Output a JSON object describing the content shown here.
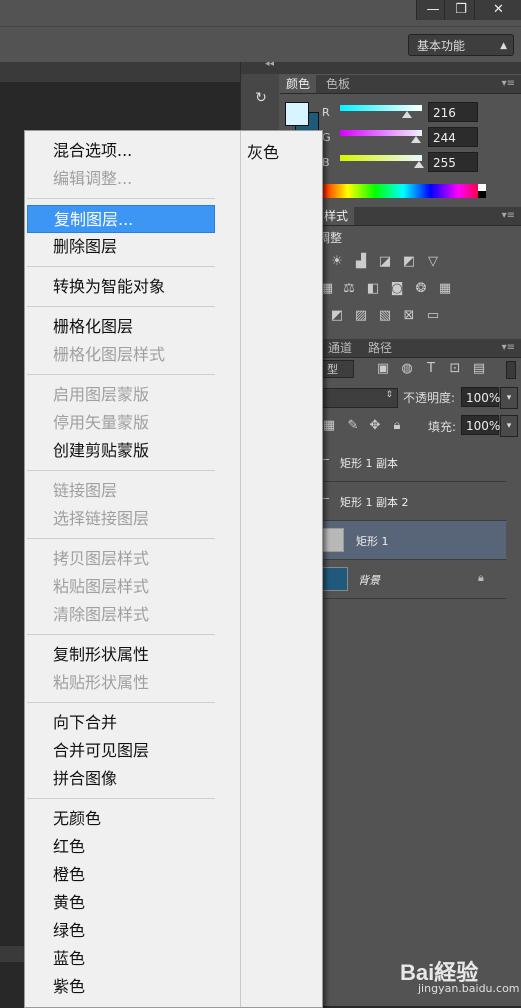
{
  "window": {
    "minimize_glyph": "—",
    "restore_glyph": "❐",
    "close_glyph": "✕"
  },
  "options_bar": {
    "workspace": "基本功能"
  },
  "color_panel": {
    "tabs": [
      "颜色",
      "色板"
    ],
    "channels": [
      {
        "label": "R",
        "value": "216",
        "fraction": 0.847
      },
      {
        "label": "G",
        "value": "244",
        "fraction": 0.957
      },
      {
        "label": "B",
        "value": "255",
        "fraction": 1.0
      }
    ],
    "foreground": "#d8f4ff"
  },
  "adjust_panel": {
    "tab": "样式",
    "title": "调整"
  },
  "layers_panel": {
    "tabs": [
      "通道",
      "路径"
    ],
    "kind_filter": "型",
    "opacity_label": "不透明度:",
    "opacity_value": "100%",
    "fill_label": "填充:",
    "fill_value": "100%",
    "layers": [
      {
        "name": "矩形 1 副本"
      },
      {
        "name": "矩形 1 副本 2"
      },
      {
        "name": "矩形 1"
      },
      {
        "name": "背景"
      }
    ]
  },
  "context_menu": {
    "side_item": "灰色",
    "items": [
      {
        "label": "混合选项...",
        "enabled": true
      },
      {
        "label": "编辑调整...",
        "enabled": false
      },
      {
        "sep": true
      },
      {
        "label": "复制图层...",
        "enabled": true,
        "highlight": true
      },
      {
        "label": "删除图层",
        "enabled": true
      },
      {
        "sep": true
      },
      {
        "label": "转换为智能对象",
        "enabled": true
      },
      {
        "sep": true
      },
      {
        "label": "栅格化图层",
        "enabled": true
      },
      {
        "label": "栅格化图层样式",
        "enabled": false
      },
      {
        "sep": true
      },
      {
        "label": "启用图层蒙版",
        "enabled": false
      },
      {
        "label": "停用矢量蒙版",
        "enabled": false
      },
      {
        "label": "创建剪贴蒙版",
        "enabled": true
      },
      {
        "sep": true
      },
      {
        "label": "链接图层",
        "enabled": false
      },
      {
        "label": "选择链接图层",
        "enabled": false
      },
      {
        "sep": true
      },
      {
        "label": "拷贝图层样式",
        "enabled": false
      },
      {
        "label": "粘贴图层样式",
        "enabled": false
      },
      {
        "label": "清除图层样式",
        "enabled": false
      },
      {
        "sep": true
      },
      {
        "label": "复制形状属性",
        "enabled": true
      },
      {
        "label": "粘贴形状属性",
        "enabled": false
      },
      {
        "sep": true
      },
      {
        "label": "向下合并",
        "enabled": true
      },
      {
        "label": "合并可见图层",
        "enabled": true
      },
      {
        "label": "拼合图像",
        "enabled": true
      },
      {
        "sep": true
      },
      {
        "label": "无颜色",
        "enabled": true
      },
      {
        "label": "红色",
        "enabled": true
      },
      {
        "label": "橙色",
        "enabled": true
      },
      {
        "label": "黄色",
        "enabled": true
      },
      {
        "label": "绿色",
        "enabled": true
      },
      {
        "label": "蓝色",
        "enabled": true
      },
      {
        "label": "紫色",
        "enabled": true
      }
    ]
  },
  "watermark": {
    "brand": "Bai経验",
    "url": "jingyan.baidu.com"
  }
}
